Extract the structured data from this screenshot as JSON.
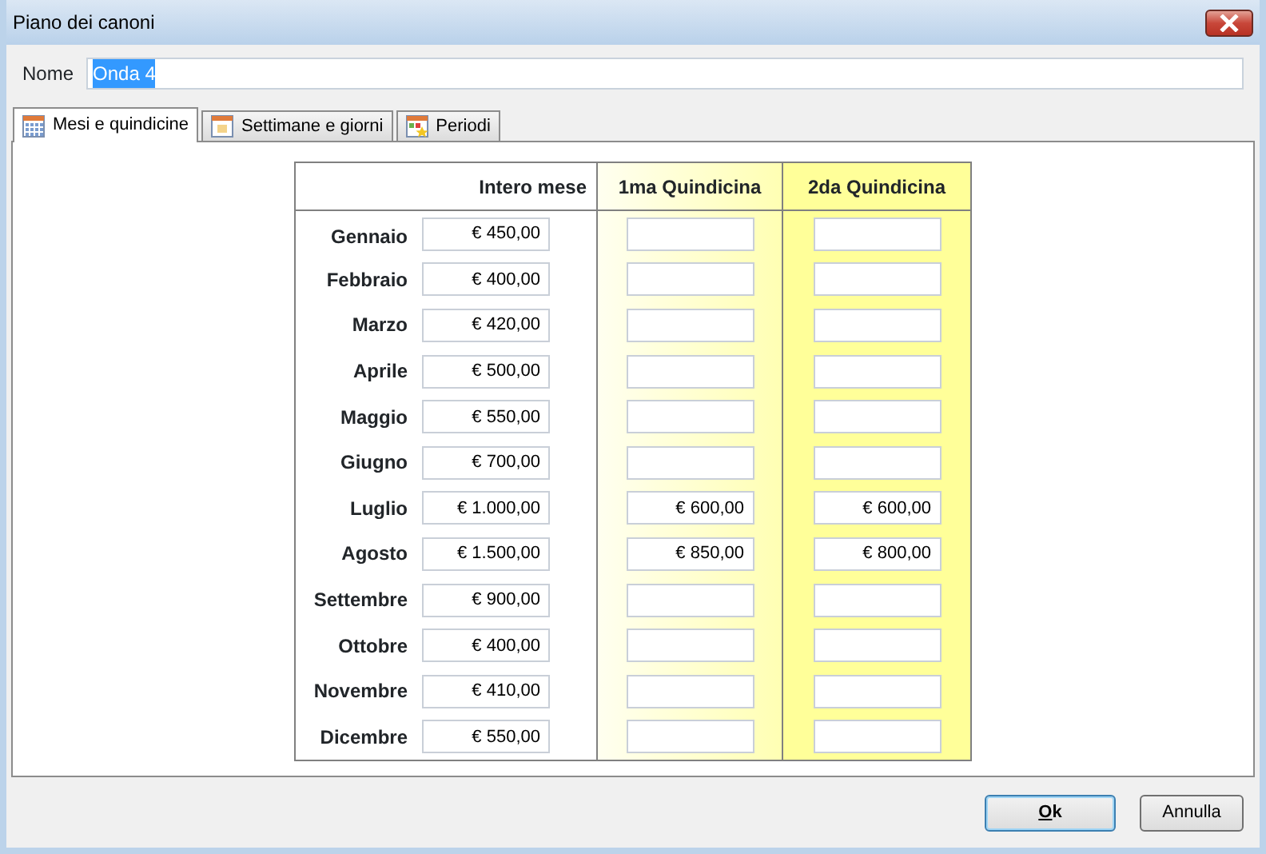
{
  "window": {
    "title": "Piano dei canoni"
  },
  "name_field": {
    "label": "Nome",
    "value": "Onda 4",
    "text_selected": true
  },
  "tabs": [
    {
      "label": "Mesi e quindicine",
      "selected": true
    },
    {
      "label": "Settimane e giorni",
      "selected": false
    },
    {
      "label": "Periodi",
      "selected": false
    }
  ],
  "table": {
    "columns": [
      "Intero mese",
      "1ma Quindicina",
      "2da Quindicina"
    ],
    "rows": [
      {
        "month": "Gennaio",
        "whole": "€ 450,00",
        "first": "",
        "second": ""
      },
      {
        "month": "Febbraio",
        "whole": "€ 400,00",
        "first": "",
        "second": ""
      },
      {
        "month": "Marzo",
        "whole": "€ 420,00",
        "first": "",
        "second": ""
      },
      {
        "month": "Aprile",
        "whole": "€ 500,00",
        "first": "",
        "second": ""
      },
      {
        "month": "Maggio",
        "whole": "€ 550,00",
        "first": "",
        "second": ""
      },
      {
        "month": "Giugno",
        "whole": "€ 700,00",
        "first": "",
        "second": ""
      },
      {
        "month": "Luglio",
        "whole": "€ 1.000,00",
        "first": "€ 600,00",
        "second": "€ 600,00"
      },
      {
        "month": "Agosto",
        "whole": "€ 1.500,00",
        "first": "€ 850,00",
        "second": "€ 800,00"
      },
      {
        "month": "Settembre",
        "whole": "€ 900,00",
        "first": "",
        "second": ""
      },
      {
        "month": "Ottobre",
        "whole": "€ 400,00",
        "first": "",
        "second": ""
      },
      {
        "month": "Novembre",
        "whole": "€ 410,00",
        "first": "",
        "second": ""
      },
      {
        "month": "Dicembre",
        "whole": "€ 550,00",
        "first": "",
        "second": ""
      }
    ]
  },
  "buttons": [
    {
      "label": "Ok",
      "default": true
    },
    {
      "label": "Annulla",
      "default": false
    }
  ]
}
